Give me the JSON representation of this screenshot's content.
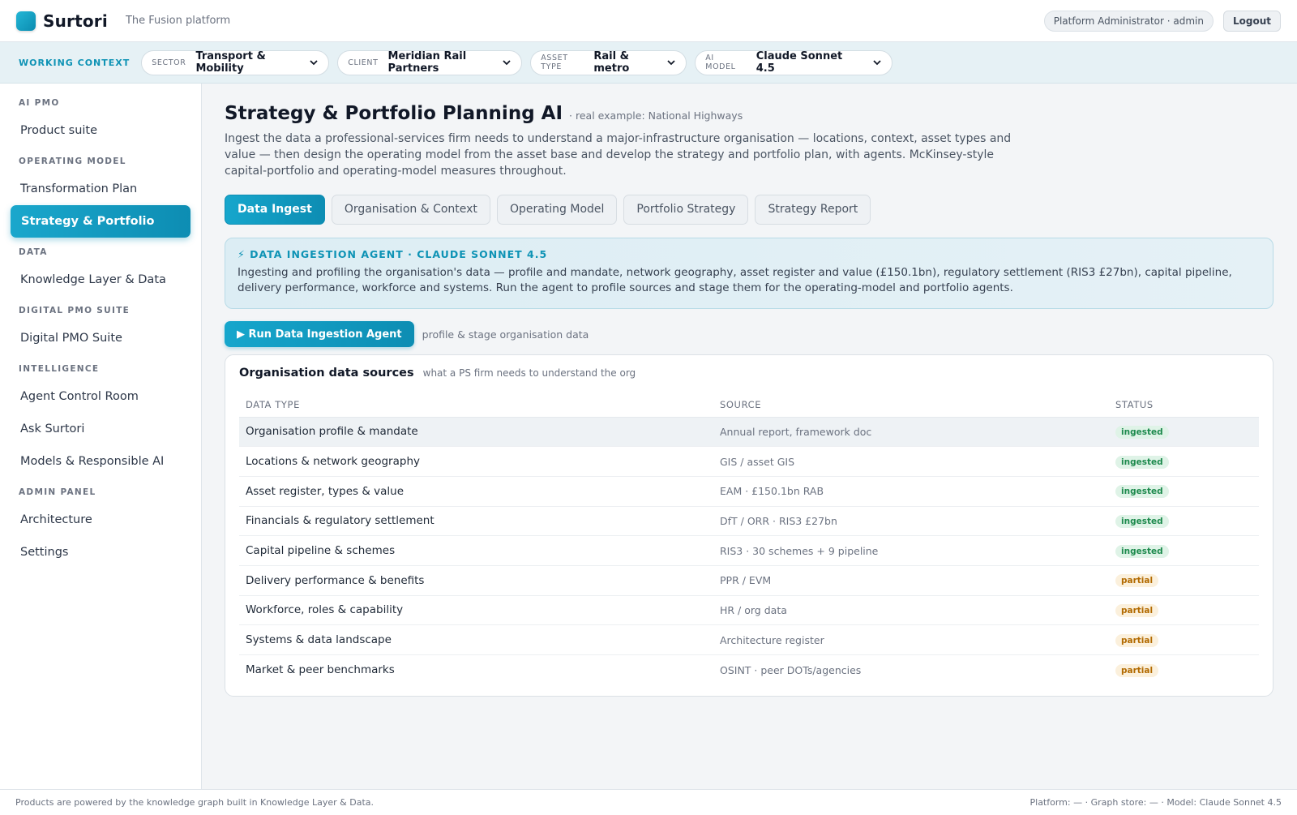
{
  "header": {
    "brand": "Surtori",
    "tagline": "The Fusion platform",
    "user": "Platform Administrator · admin",
    "logout_label": "Logout"
  },
  "context": {
    "label": "WORKING CONTEXT",
    "sector": {
      "key": "SECTOR",
      "value": "Transport & Mobility"
    },
    "client": {
      "key": "CLIENT",
      "value": "Meridian Rail Partners"
    },
    "asset_type": {
      "key": "ASSET TYPE",
      "value": "Rail & metro"
    },
    "ai_model": {
      "key": "AI MODEL",
      "value": "Claude Sonnet 4.5"
    }
  },
  "sidebar": {
    "sections": [
      {
        "title": "AI PMO",
        "items": [
          "Product suite"
        ]
      },
      {
        "title": "OPERATING MODEL",
        "items": [
          "Transformation Plan",
          "Strategy & Portfolio"
        ]
      },
      {
        "title": "DATA",
        "items": [
          "Knowledge Layer & Data"
        ]
      },
      {
        "title": "DIGITAL PMO SUITE",
        "items": [
          "Digital PMO Suite"
        ]
      },
      {
        "title": "INTELLIGENCE",
        "items": [
          "Agent Control Room",
          "Ask Surtori",
          "Models & Responsible AI"
        ]
      },
      {
        "title": "ADMIN PANEL",
        "items": [
          "Architecture",
          "Settings"
        ]
      }
    ],
    "active": "Strategy & Portfolio"
  },
  "main": {
    "title": "Strategy & Portfolio Planning AI",
    "subtitle": "· real example: National Highways",
    "description": "Ingest the data a professional-services firm needs to understand a major-infrastructure organisation — locations, context, asset types and value — then design the operating model from the asset base and develop the strategy and portfolio plan, with agents. McKinsey-style capital-portfolio and operating-model measures throughout.",
    "tabs": [
      {
        "label": "Data Ingest",
        "active": true
      },
      {
        "label": "Organisation & Context",
        "active": false
      },
      {
        "label": "Operating Model",
        "active": false
      },
      {
        "label": "Portfolio Strategy",
        "active": false
      },
      {
        "label": "Strategy Report",
        "active": false
      }
    ],
    "agent": {
      "heading": "⚡ DATA INGESTION AGENT · CLAUDE SONNET 4.5",
      "text": "Ingesting and profiling the organisation's data — profile and mandate, network geography, asset register and value (£150.1bn), regulatory settlement (RIS3 £27bn), capital pipeline, delivery performance, workforce and systems. Run the agent to profile sources and stage them for the operating-model and portfolio agents."
    },
    "run_button": "▶ Run Data Ingestion Agent",
    "run_hint": "profile & stage organisation data",
    "sources": {
      "title": "Organisation data sources",
      "subtitle": "what a PS firm needs to understand the org",
      "columns": [
        "DATA TYPE",
        "SOURCE",
        "STATUS"
      ],
      "rows": [
        {
          "type": "Organisation profile & mandate",
          "source": "Annual report, framework doc",
          "status": "ingested"
        },
        {
          "type": "Locations & network geography",
          "source": "GIS / asset GIS",
          "status": "ingested"
        },
        {
          "type": "Asset register, types & value",
          "source": "EAM · £150.1bn RAB",
          "status": "ingested"
        },
        {
          "type": "Financials & regulatory settlement",
          "source": "DfT / ORR · RIS3 £27bn",
          "status": "ingested"
        },
        {
          "type": "Capital pipeline & schemes",
          "source": "RIS3 · 30 schemes + 9 pipeline",
          "status": "ingested"
        },
        {
          "type": "Delivery performance & benefits",
          "source": "PPR / EVM",
          "status": "partial"
        },
        {
          "type": "Workforce, roles & capability",
          "source": "HR / org data",
          "status": "partial"
        },
        {
          "type": "Systems & data landscape",
          "source": "Architecture register",
          "status": "partial"
        },
        {
          "type": "Market & peer benchmarks",
          "source": "OSINT · peer DOTs/agencies",
          "status": "partial"
        }
      ]
    }
  },
  "footer": {
    "left": "Products are powered by the knowledge graph built in Knowledge Layer & Data.",
    "right": "Platform: — · Graph store: — · Model: Claude Sonnet 4.5"
  },
  "colors": {
    "accent": "#0e93b5",
    "ingested": "#1d8a4d",
    "partial": "#b26a00"
  }
}
